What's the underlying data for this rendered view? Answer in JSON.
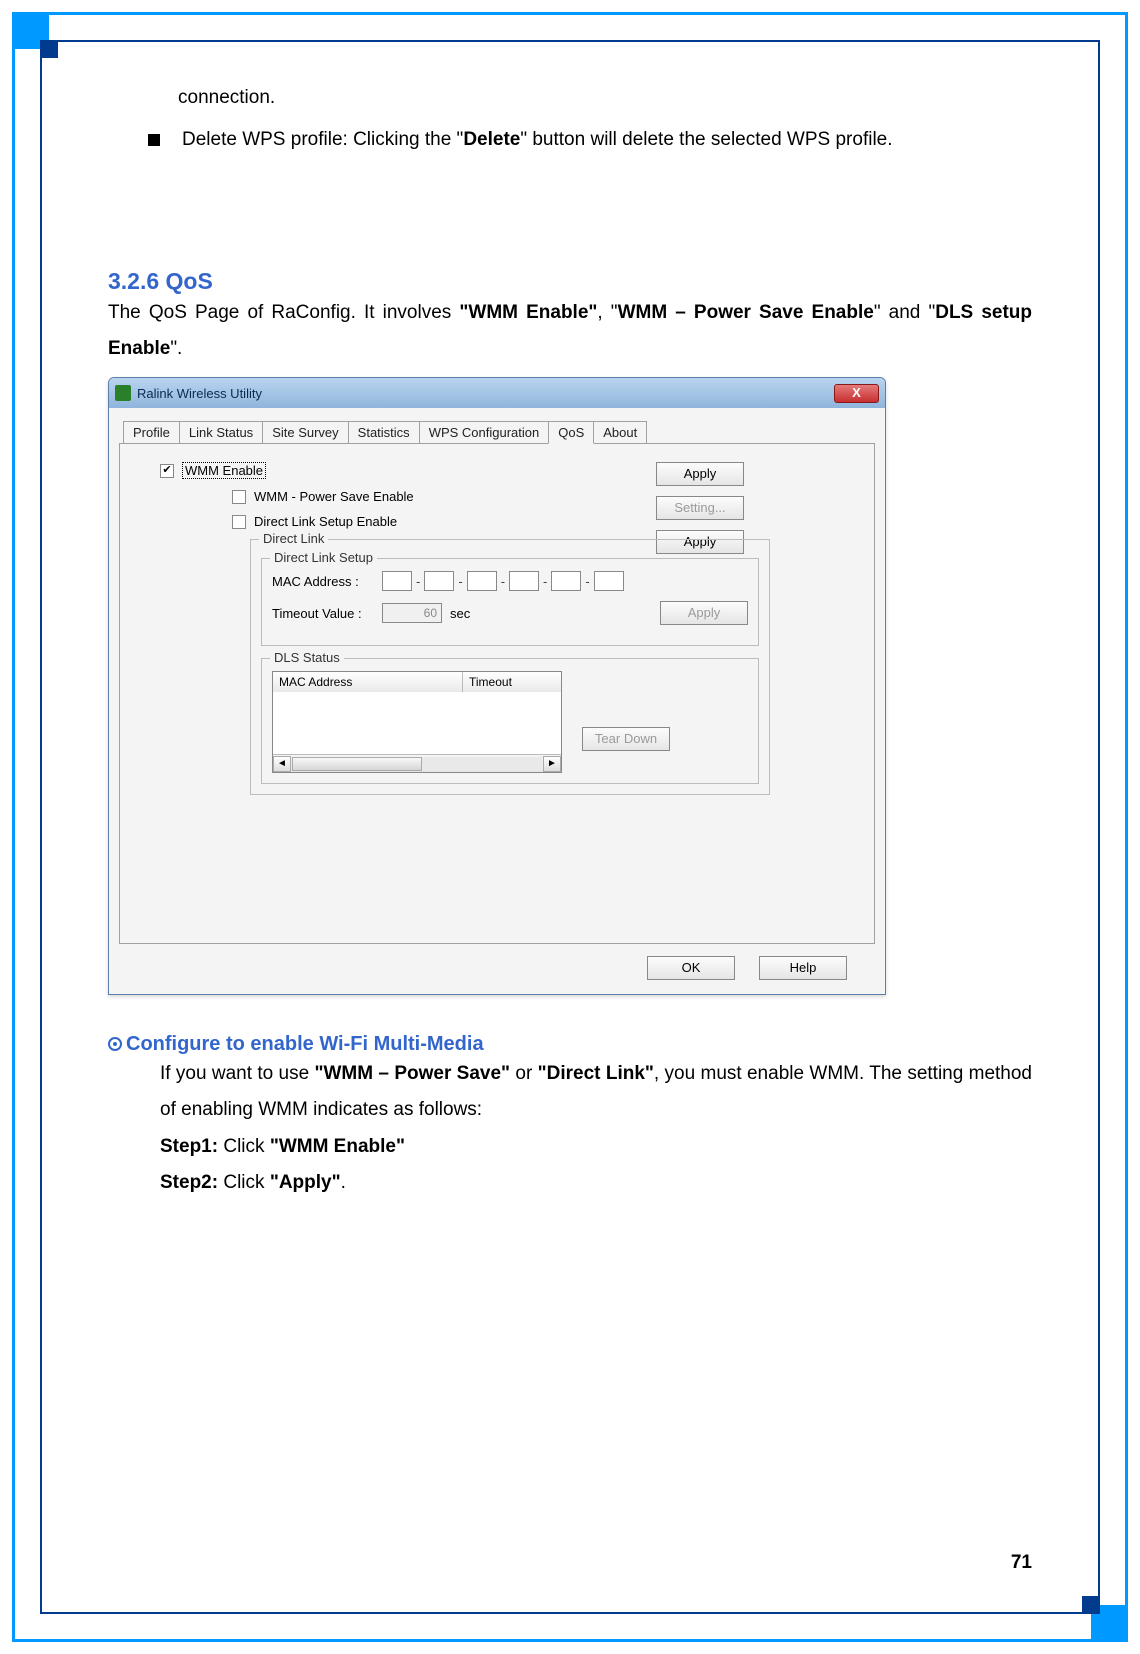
{
  "intro": {
    "line1": "connection.",
    "bullet": {
      "prefix": "Delete WPS profile: Clicking the \"",
      "bold": "Delete",
      "suffix": "\" button will delete the selected WPS profile."
    }
  },
  "heading": "3.2.6   QoS",
  "paragraph": {
    "p1": "The QoS Page of RaConfig. It involves ",
    "b1": "\"WMM Enable\"",
    "p2": ", \"",
    "b2": "WMM – Power Save Enable",
    "p3": "\" and \"",
    "b3": "DLS setup Enable",
    "p4": "\"."
  },
  "window": {
    "title": "Ralink Wireless Utility",
    "close": "X",
    "tabs": [
      "Profile",
      "Link Status",
      "Site Survey",
      "Statistics",
      "WPS Configuration",
      "QoS",
      "About"
    ],
    "wmm_enable_label": "WMM Enable",
    "wmm_ps_label": "WMM - Power Save Enable",
    "dls_enable_label": "Direct Link Setup Enable",
    "apply1": "Apply",
    "setting": "Setting...",
    "apply2": "Apply",
    "direct_link_legend": "Direct Link",
    "direct_link_setup_legend": "Direct Link Setup",
    "mac_label": "MAC Address :",
    "timeout_label": "Timeout Value :",
    "timeout_value": "60",
    "timeout_unit": "sec",
    "apply3": "Apply",
    "dls_status_legend": "DLS Status",
    "col_mac": "MAC Address",
    "col_timeout": "Timeout",
    "tear_down": "Tear Down",
    "ok": "OK",
    "help": "Help"
  },
  "configure": {
    "heading": "Configure to enable Wi-Fi Multi-Media",
    "line1a": "If you want to use ",
    "line1b": "\"WMM – Power Save\"",
    "line1c": " or ",
    "line1d": "\"Direct Link\"",
    "line1e": ", you must enable WMM. The setting method of enabling WMM indicates as follows:",
    "step1a": "Step1:",
    "step1b": " Click ",
    "step1c": "\"WMM Enable\"",
    "step2a": "Step2:",
    "step2b": " Click ",
    "step2c": "\"Apply\"",
    "step2d": "."
  },
  "page_number": "71"
}
